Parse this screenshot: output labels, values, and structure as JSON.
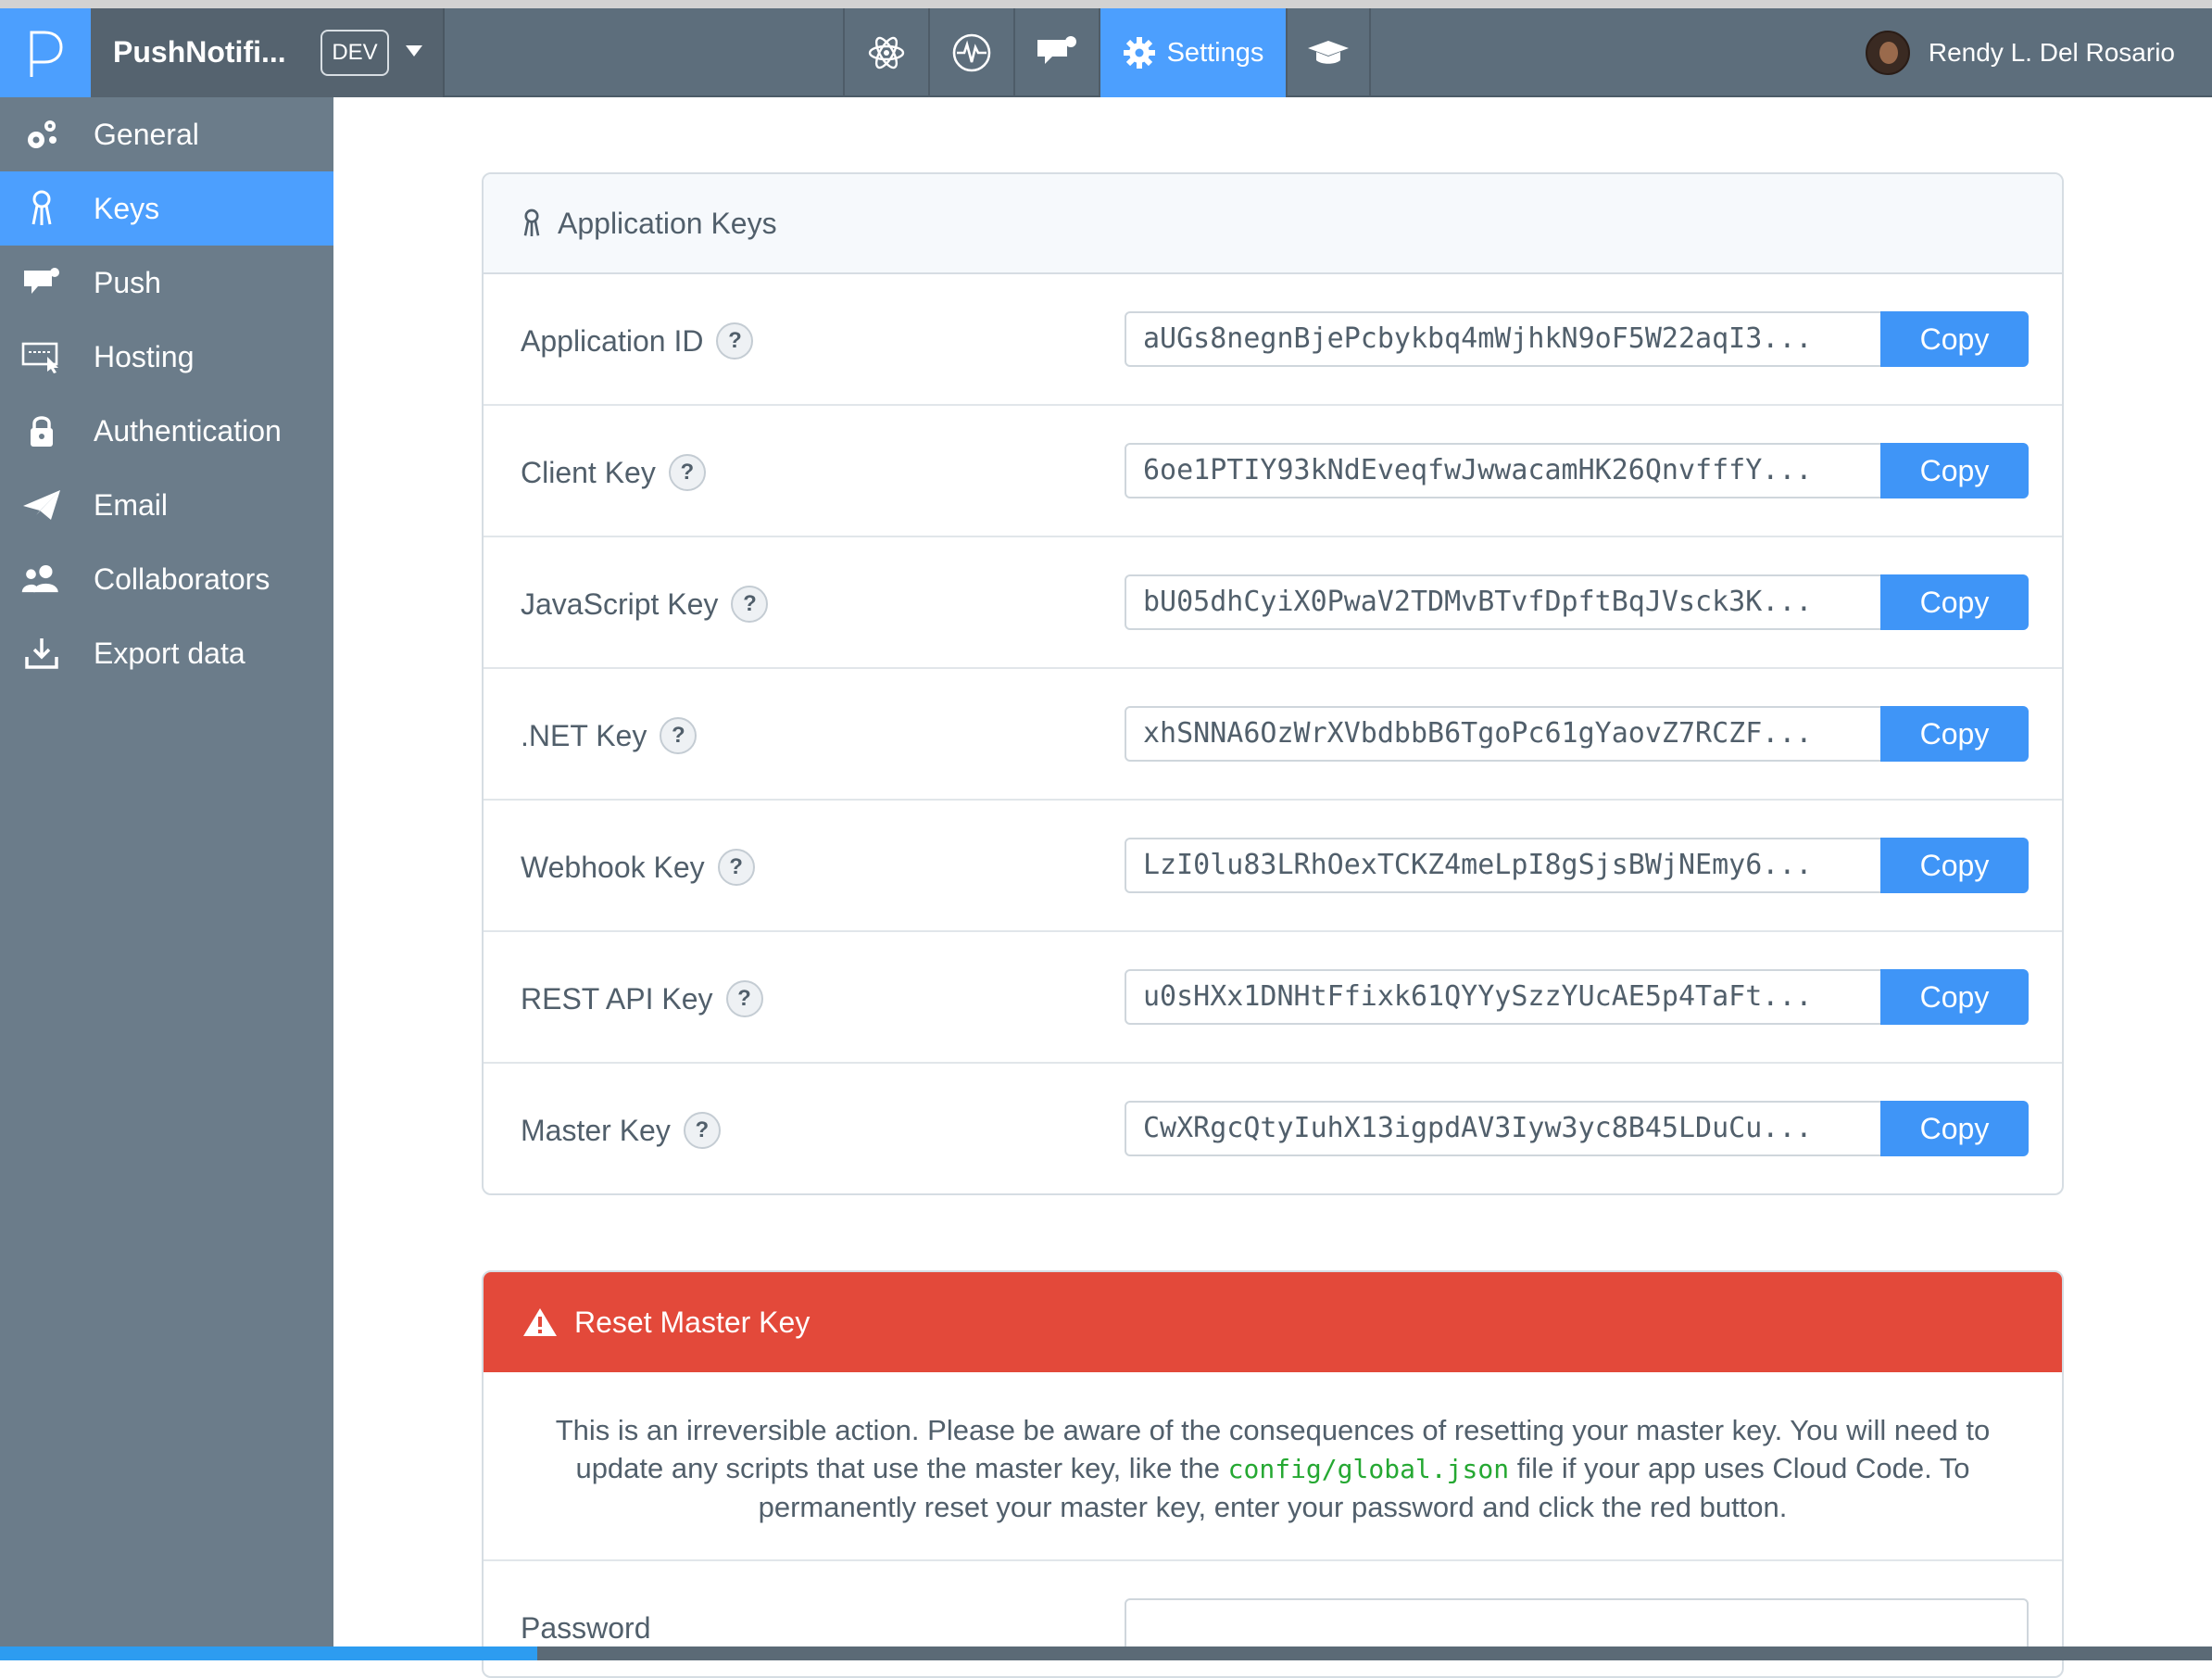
{
  "header": {
    "app_name": "PushNotifi...",
    "env": "DEV",
    "nav": [
      {
        "icon": "atom-icon"
      },
      {
        "icon": "pulse-icon"
      },
      {
        "icon": "push-chat-icon"
      },
      {
        "icon": "gear-icon",
        "label": "Settings",
        "active": true
      },
      {
        "icon": "graduation-cap-icon"
      }
    ],
    "user_name": "Rendy L. Del Rosario"
  },
  "sidebar": {
    "items": [
      {
        "label": "General",
        "icon": "gears-icon",
        "active": false
      },
      {
        "label": "Keys",
        "icon": "keys-icon",
        "active": true
      },
      {
        "label": "Push",
        "icon": "push-icon",
        "active": false
      },
      {
        "label": "Hosting",
        "icon": "hosting-icon",
        "active": false
      },
      {
        "label": "Authentication",
        "icon": "lock-icon",
        "active": false
      },
      {
        "label": "Email",
        "icon": "paper-plane-icon",
        "active": false
      },
      {
        "label": "Collaborators",
        "icon": "people-icon",
        "active": false
      },
      {
        "label": "Export data",
        "icon": "download-icon",
        "active": false
      }
    ]
  },
  "keys_panel": {
    "title": "Application Keys",
    "copy_label": "Copy",
    "help_glyph": "?",
    "rows": [
      {
        "label": "Application ID",
        "value": "aUGs8negnBjePcbykbq4mWjhkN9oF5W22aqI3..."
      },
      {
        "label": "Client Key",
        "value": "6oe1PTIY93kNdEveqfwJwwacamHK26QnvfffY..."
      },
      {
        "label": "JavaScript Key",
        "value": "bU05dhCyiX0PwaV2TDMvBTvfDpftBqJVsck3K..."
      },
      {
        "label": ".NET Key",
        "value": "xhSNNA6OzWrXVbdbbB6TgoPc61gYaovZ7RCZF..."
      },
      {
        "label": "Webhook Key",
        "value": "LzI0lu83LRhOexTCKZ4meLpI8gSjsBWjNEmy6..."
      },
      {
        "label": "REST API Key",
        "value": "u0sHXx1DNHtFfixk61QYYySzzYUcAE5p4TaFt..."
      },
      {
        "label": "Master Key",
        "value": "CwXRgcQtyIuhX13igpdAV3Iyw3yc8B45LDuCu..."
      }
    ]
  },
  "reset_panel": {
    "title": "Reset Master Key",
    "text_before": "This is an irreversible action. Please be aware of the consequences of resetting your master key. You will need to update any scripts that use the master key, like the ",
    "code": "config/global.json",
    "text_after": " file if your app uses Cloud Code. To permanently reset your master key, enter your password and click the red button.",
    "password_label": "Password",
    "password_value": ""
  },
  "colors": {
    "accent": "#4c9ffe",
    "danger": "#e3493a",
    "sidebar": "#6b7c8a",
    "header": "#5d6e7c"
  }
}
